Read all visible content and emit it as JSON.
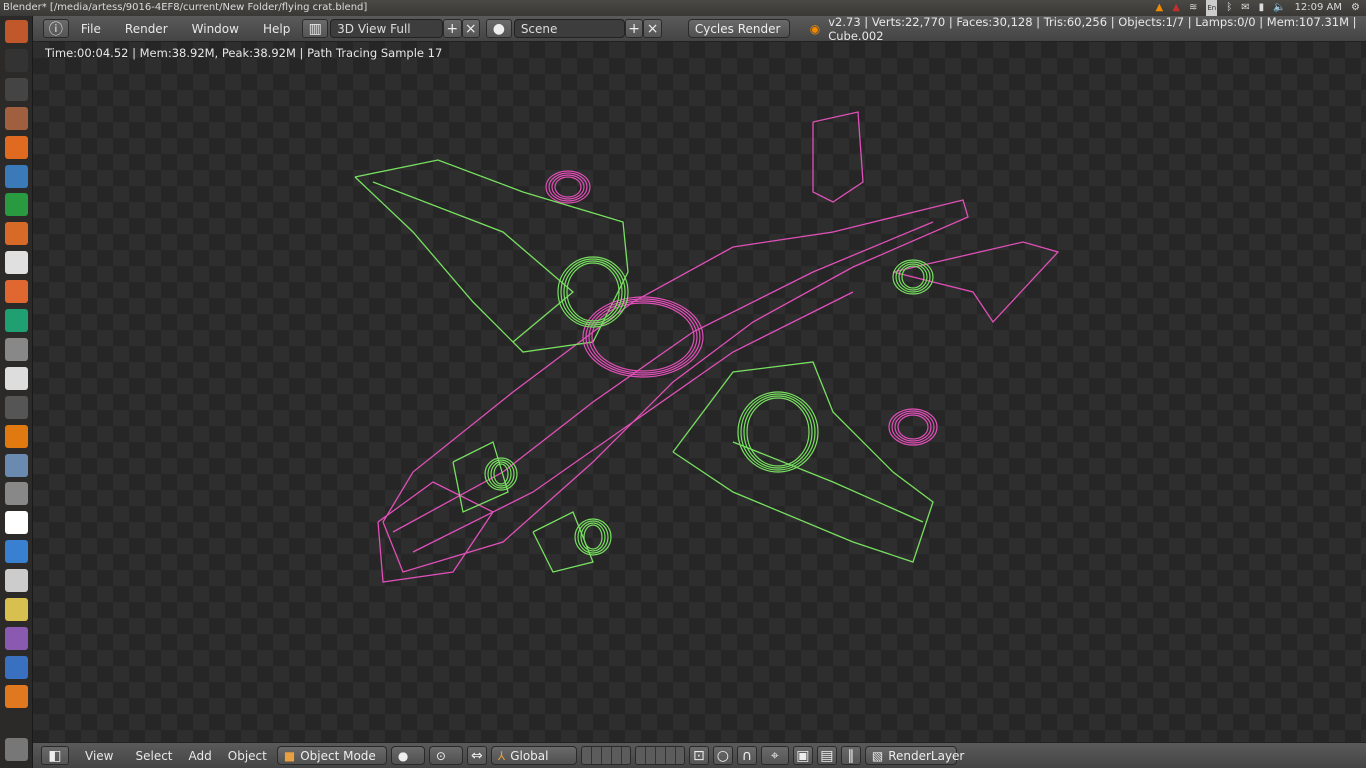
{
  "window": {
    "title": "Blender* [/media/artess/9016-4EF8/current/New Folder/flying crat.blend]"
  },
  "tray": {
    "clock": "12:09 AM",
    "icons": [
      "vlc-icon",
      "warning-icon",
      "wifi-icon",
      "keyboard-en-icon",
      "bluetooth-icon",
      "mail-icon",
      "battery-icon",
      "volume-icon",
      "gear-icon"
    ],
    "keyboard": "En"
  },
  "launcher": {
    "icons": [
      "ubuntu-dash-icon",
      "terminal-icon",
      "files-icon",
      "archive-icon",
      "firefox-icon",
      "writer-icon",
      "calc-icon",
      "impress-icon",
      "photos-icon",
      "software-center-icon",
      "headphones-icon",
      "usb-icon",
      "disc-icon",
      "phone-icon",
      "vlc-icon",
      "disk-icon",
      "gimp-icon",
      "gmail-icon",
      "video-player-icon",
      "webcam-icon",
      "game-icon",
      "film-icon",
      "blender-alt-icon",
      "blender-icon",
      "trash-icon"
    ]
  },
  "header": {
    "menus": [
      "File",
      "Render",
      "Window",
      "Help"
    ],
    "screen_layout": "3D View Full",
    "scene": "Scene",
    "render_engine": "Cycles Render",
    "stats": "v2.73 | Verts:22,770 | Faces:30,128 | Tris:60,256 | Objects:1/7 | Lamps:0/0 | Mem:107.31M | Cube.002"
  },
  "viewport": {
    "status": "Time:00:04.52 | Mem:38.92M, Peak:38.92M | Path Tracing Sample 17",
    "colors": {
      "pink": "#e050b8",
      "green": "#78e060"
    }
  },
  "footer": {
    "menus": [
      "View",
      "Select",
      "Add",
      "Object"
    ],
    "mode": "Object Mode",
    "orientation": "Global",
    "render_layer": "RenderLayer"
  }
}
